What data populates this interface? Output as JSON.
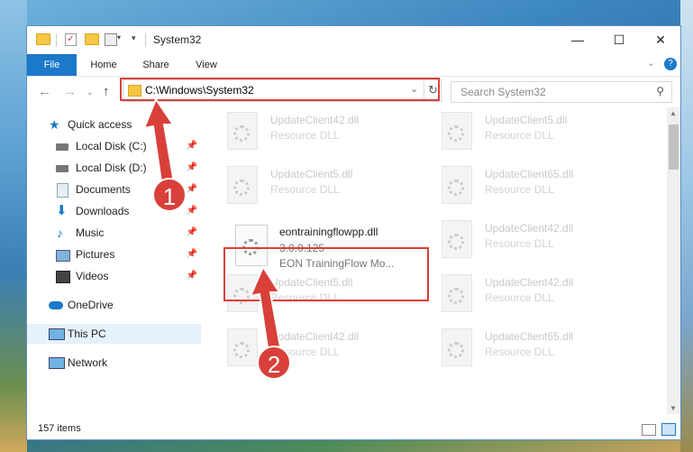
{
  "window": {
    "title": "System32"
  },
  "ribbon": {
    "tabs": [
      "File",
      "Home",
      "Share",
      "View"
    ]
  },
  "address": {
    "path": "C:\\Windows\\System32",
    "search_placeholder": "Search System32"
  },
  "nav": {
    "items": [
      {
        "label": "Quick access",
        "icon": "star-icon"
      },
      {
        "label": "Local Disk (C:)",
        "icon": "drive-icon"
      },
      {
        "label": "Local Disk (D:)",
        "icon": "drive-icon"
      },
      {
        "label": "Documents",
        "icon": "documents-icon"
      },
      {
        "label": "Downloads",
        "icon": "download-icon"
      },
      {
        "label": "Music",
        "icon": "music-icon"
      },
      {
        "label": "Pictures",
        "icon": "pictures-icon"
      },
      {
        "label": "Videos",
        "icon": "videos-icon"
      },
      {
        "label": "OneDrive",
        "icon": "cloud-icon"
      },
      {
        "label": "This PC",
        "icon": "computer-icon"
      },
      {
        "label": "Network",
        "icon": "network-icon"
      }
    ]
  },
  "files": [
    {
      "name": "UpdateClient42.dll",
      "type": "Resource DLL"
    },
    {
      "name": "UpdateClient5.dll",
      "type": "Resource DLL"
    },
    {
      "name": "UpdateClient5.dll",
      "type": "Resource DLL"
    },
    {
      "name": "UpdateClient65.dll",
      "type": "Resource DLL"
    },
    {
      "name": "UpdateClient42.dll",
      "type": "Resource DLL"
    },
    {
      "name": "UpdateClient5.dll",
      "type": "Resource DLL"
    },
    {
      "name": "UpdateClient42.dll",
      "type": "Resource DLL"
    },
    {
      "name": "UpdateClient42.dll",
      "type": "Resource DLL"
    },
    {
      "name": "UpdateClient65.dll",
      "type": "Resource DLL"
    }
  ],
  "focus_file": {
    "name": "eontrainingflowpp.dll",
    "version": "3.0.0.125",
    "description": "EON TrainingFlow Mo..."
  },
  "status": {
    "items": "157 items"
  },
  "callouts": {
    "one": "1",
    "two": "2"
  },
  "colors": {
    "accent": "#1979ca",
    "callout": "#d9403a"
  }
}
